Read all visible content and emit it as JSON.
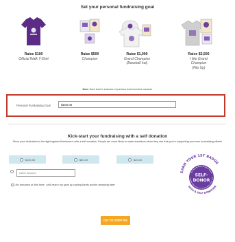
{
  "header": {
    "title": "Set your personal fundraising goal"
  },
  "rewards": [
    {
      "amount": "Raise $100",
      "name": "Official Walk T-Shirt"
    },
    {
      "amount": "Raise $500",
      "name": "Champion"
    },
    {
      "amount": "Raise $1,000",
      "name": "Grand Champion",
      "extra": "(Baseball hat)"
    },
    {
      "amount": "Raise $2,500",
      "name": "I like Grand",
      "extra": "Champion",
      "extra2": "(Flip Up)"
    }
  ],
  "note": {
    "bold": "Note:",
    "text": " Each level is inclusive of previous level incentive rewards."
  },
  "goal": {
    "label": "Personal Fundraising Goal",
    "value": "$100.00"
  },
  "self_donation": {
    "title": "Kick-start your fundraising with a self donation",
    "description": "Show your dedication to the fight against Alzheimer's with a self donation. People are more likely to make donations when they see that you're supporting your own fundraising efforts!",
    "amounts": [
      "$100.00",
      "$50.00",
      "$25.00"
    ],
    "other_placeholder": "Other Amount",
    "no_donation_text": "No donation at this time; I will reach my goal by raising funds and/or donating later.",
    "badge": {
      "top": "EARN YOUR 1ST BADGE",
      "center": "SELF-DONOR",
      "bottom": "WITH A SELF DONATION"
    }
  },
  "actions": {
    "next_label": "GO TO STEP 3/4"
  },
  "colors": {
    "shirt": "#5b2b86",
    "accent_red": "#c0392b",
    "button_orange": "#f5a623",
    "amount_bg": "#cfe7ef",
    "badge_purple": "#6a3ea1"
  }
}
